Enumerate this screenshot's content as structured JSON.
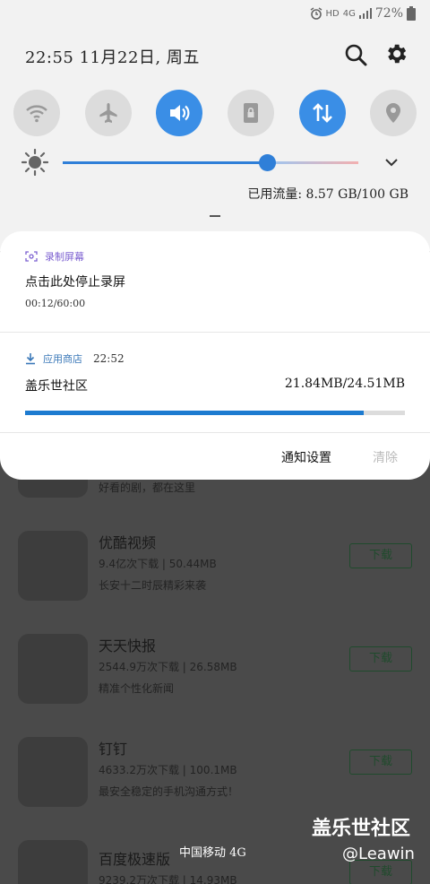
{
  "status_bar": {
    "alarm_icon": "alarm-clock-icon",
    "hd_label": "HD",
    "network_label": "4G",
    "battery_text": "72%"
  },
  "header": {
    "time_date": "22:55  11月22日, 周五",
    "search_icon": "search-icon",
    "settings_icon": "gear-icon"
  },
  "quick_settings": [
    {
      "name": "wifi",
      "icon": "wifi-icon",
      "active": false
    },
    {
      "name": "airplane",
      "icon": "airplane-icon",
      "active": false
    },
    {
      "name": "sound",
      "icon": "speaker-icon",
      "active": true
    },
    {
      "name": "screen-rotation-lock",
      "icon": "rotation-lock-icon",
      "active": false
    },
    {
      "name": "mobile-data",
      "icon": "data-arrows-icon",
      "active": true
    },
    {
      "name": "location",
      "icon": "location-pin-icon",
      "active": false
    }
  ],
  "brightness": {
    "level": 0.69
  },
  "data_usage": "已用流量: 8.57 GB/100 GB",
  "notifications": {
    "recording": {
      "app": "录制屏幕",
      "title": "点击此处停止录屏",
      "elapsed": "00:12/60:00"
    },
    "download": {
      "app": "应用商店",
      "time": "22:52",
      "title": "盖乐世社区",
      "size": "21.84MB/24.51MB",
      "progress": 0.891
    },
    "settings_label": "通知设置",
    "clear_label": "清除"
  },
  "app_list": {
    "partial_desc": "好看的剧，都在这里",
    "items": [
      {
        "name": "优酷视频",
        "meta": "9.4亿次下载 | 50.44MB",
        "desc": "长安十二时辰精彩来袭",
        "button": "下载"
      },
      {
        "name": "天天快报",
        "meta": "2544.9万次下载 | 26.58MB",
        "desc": "精准个性化新闻",
        "button": "下载"
      },
      {
        "name": "钉钉",
        "meta": "4633.2万次下载 | 100.1MB",
        "desc": "最安全稳定的手机沟通方式！",
        "button": "下载"
      },
      {
        "name": "百度极速版",
        "meta": "9239.2万次下载 | 14.93MB",
        "desc": "",
        "button": "下载"
      }
    ]
  },
  "carrier": "中国移动 4G",
  "watermark": {
    "title": "盖乐世社区",
    "user": "@Leawin"
  }
}
